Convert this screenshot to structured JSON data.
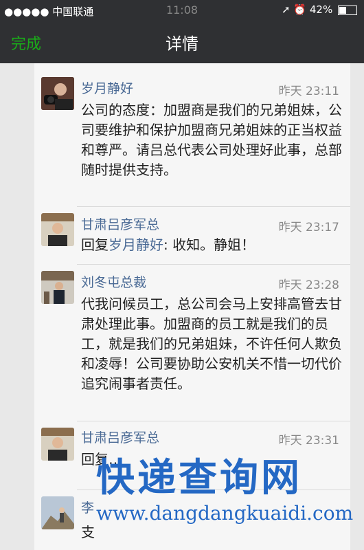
{
  "status_bar": {
    "carrier": "●●●●● 中国联通",
    "time": "11:08",
    "battery": "42%"
  },
  "nav": {
    "done": "完成",
    "title": "详情"
  },
  "comments": [
    {
      "name": "岁月静好",
      "time": "昨天 23:11",
      "text": "公司的态度：加盟商是我们的兄弟姐妹，公司要维护和保护加盟商兄弟姐妹的正当权益和尊严。请吕总代表公司处理好此事，总部随时提供支持。"
    },
    {
      "name": "甘肃吕彦军总",
      "time": "昨天 23:17",
      "reply_prefix": "回复",
      "reply_to": "岁月静好",
      "text": ": 收知。静姐！"
    },
    {
      "name": "刘冬屯总裁",
      "time": "昨天 23:28",
      "text": "代我问候员工，总公司会马上安排高管去甘肃处理此事。加盟商的员工就是我们的员工，就是我们的兄弟姐妹，不许任何人欺负和凌辱！公司要协助公安机关不惜一切代价追究闹事者责任。"
    },
    {
      "name": "甘肃吕彦军总",
      "time": "昨天 23:31",
      "text": "回复…"
    },
    {
      "name": "李",
      "text": "支"
    }
  ],
  "watermark": {
    "title": "快递查询网",
    "url": "www.dangdangkuaidi.com"
  }
}
